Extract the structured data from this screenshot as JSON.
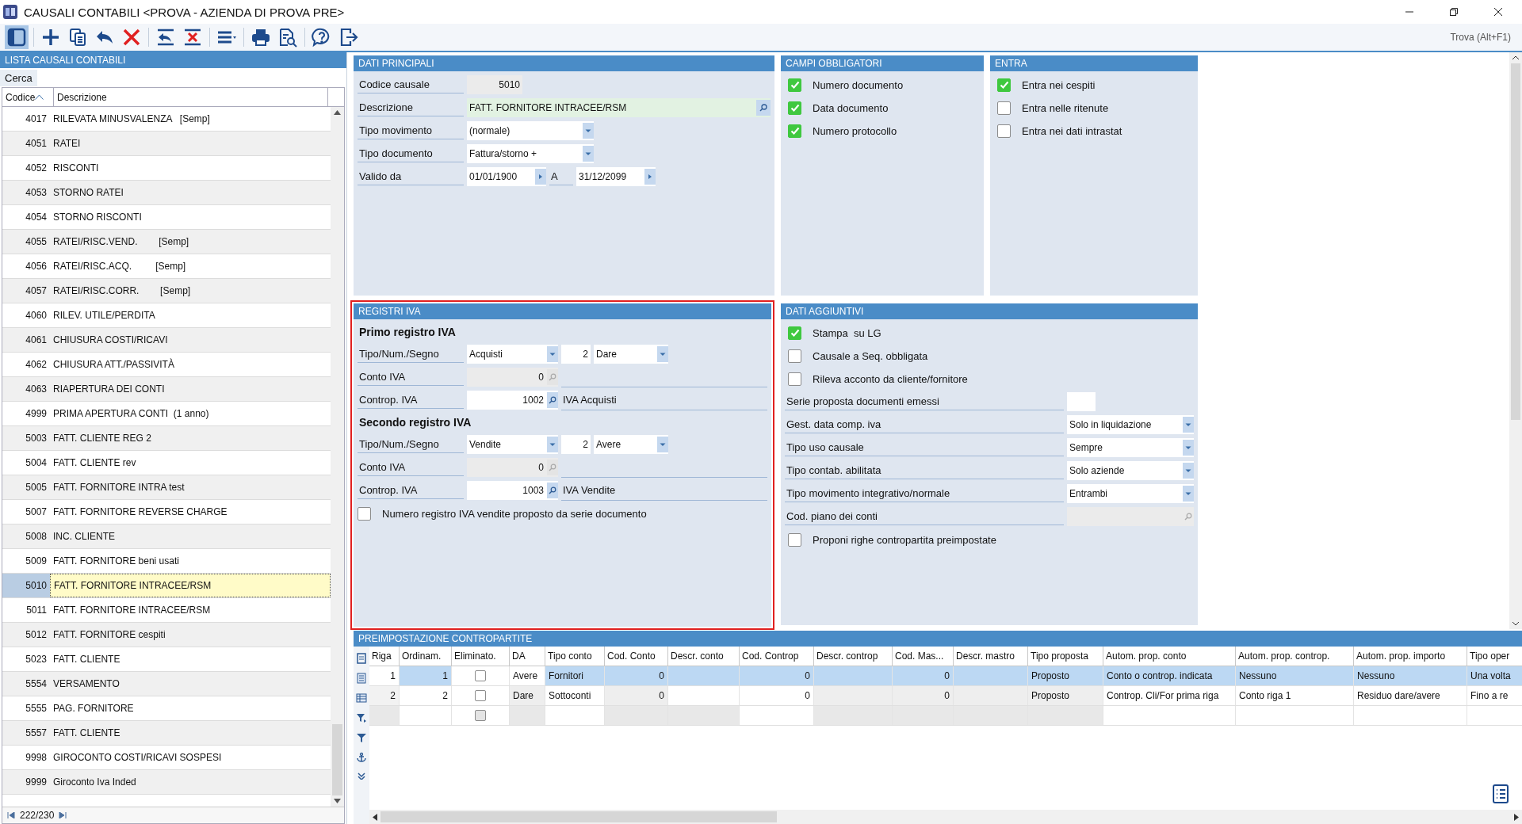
{
  "window": {
    "title": "CAUSALI CONTABILI <PROVA - AZIENDA DI PROVA PRE>"
  },
  "toolbar": {
    "buttons": [
      {
        "kind": "panel",
        "selected": true
      },
      {
        "kind": "new",
        "selected": false
      },
      {
        "kind": "copy",
        "selected": false
      },
      {
        "kind": "undo",
        "selected": false
      },
      {
        "kind": "delete",
        "selected": false
      },
      {
        "kind": "undo-line",
        "selected": false
      },
      {
        "kind": "delete-line",
        "selected": false
      },
      {
        "kind": "menu",
        "selected": false
      },
      {
        "kind": "print",
        "selected": false
      },
      {
        "kind": "preview",
        "selected": false
      },
      {
        "kind": "help",
        "selected": false
      },
      {
        "kind": "exit",
        "selected": false
      }
    ],
    "find_hint": "Trova (Alt+F1)"
  },
  "list": {
    "title": "LISTA CAUSALI CONTABILI",
    "search_label": "Cerca",
    "columns": [
      "Codice",
      "Descrizione"
    ],
    "rows": [
      {
        "code": "4017",
        "description": "RILEVATA MINUSVALENZA   [Semp]",
        "selected": false
      },
      {
        "code": "4051",
        "description": "RATEI",
        "selected": false
      },
      {
        "code": "4052",
        "description": "RISCONTI",
        "selected": false
      },
      {
        "code": "4053",
        "description": "STORNO RATEI",
        "selected": false
      },
      {
        "code": "4054",
        "description": "STORNO RISCONTI",
        "selected": false
      },
      {
        "code": "4055",
        "description": "RATEI/RISC.VEND.        [Semp]",
        "selected": false
      },
      {
        "code": "4056",
        "description": "RATEI/RISC.ACQ.         [Semp]",
        "selected": false
      },
      {
        "code": "4057",
        "description": "RATEI/RISC.CORR.        [Semp]",
        "selected": false
      },
      {
        "code": "4060",
        "description": "RILEV. UTILE/PERDITA",
        "selected": false
      },
      {
        "code": "4061",
        "description": "CHIUSURA COSTI/RICAVI",
        "selected": false
      },
      {
        "code": "4062",
        "description": "CHIUSURA ATT./PASSIVITÀ",
        "selected": false
      },
      {
        "code": "4063",
        "description": "RIAPERTURA DEI CONTI",
        "selected": false
      },
      {
        "code": "4999",
        "description": "PRIMA APERTURA CONTI  (1 anno)",
        "selected": false
      },
      {
        "code": "5003",
        "description": "FATT. CLIENTE REG 2",
        "selected": false
      },
      {
        "code": "5004",
        "description": "FATT. CLIENTE rev",
        "selected": false
      },
      {
        "code": "5005",
        "description": "FATT. FORNITORE INTRA test",
        "selected": false
      },
      {
        "code": "5007",
        "description": "FATT. FORNITORE REVERSE CHARGE",
        "selected": false
      },
      {
        "code": "5008",
        "description": "INC. CLIENTE",
        "selected": false
      },
      {
        "code": "5009",
        "description": "FATT. FORNITORE beni usati",
        "selected": false
      },
      {
        "code": "5010",
        "description": "FATT. FORNITORE INTRACEE/RSM",
        "selected": true
      },
      {
        "code": "5011",
        "description": "FATT. FORNITORE INTRACEE/RSM",
        "selected": false
      },
      {
        "code": "5012",
        "description": "FATT. FORNITORE cespiti",
        "selected": false
      },
      {
        "code": "5023",
        "description": "FATT. CLIENTE",
        "selected": false
      },
      {
        "code": "5554",
        "description": "VERSAMENTO",
        "selected": false
      },
      {
        "code": "5555",
        "description": "PAG. FORNITORE",
        "selected": false
      },
      {
        "code": "5557",
        "description": "FATT. CLIENTE",
        "selected": false
      },
      {
        "code": "9998",
        "description": "GIROCONTO COSTI/RICAVI SOSPESI",
        "selected": false
      },
      {
        "code": "9999",
        "description": "Giroconto Iva Inded",
        "selected": false
      }
    ],
    "pager": "222/230"
  },
  "dati_principali": {
    "title": "DATI PRINCIPALI",
    "fields": [
      {
        "label": "Codice causale",
        "kind": "readonly",
        "value": "5010"
      },
      {
        "label": "Descrizione",
        "kind": "lookup",
        "value": "FATT. FORNITORE INTRACEE/RSM"
      },
      {
        "label": "Tipo movimento",
        "kind": "select",
        "value": "(normale)"
      },
      {
        "label": "Tipo documento",
        "kind": "select",
        "value": "Fattura/storno +"
      },
      {
        "label": "Valido da",
        "kind": "range",
        "value": "01/01/1900",
        "to_label": "A",
        "to_value": "31/12/2099"
      }
    ]
  },
  "campi_obbligatori": {
    "title": "CAMPI OBBLIGATORI",
    "items": [
      {
        "label": "Numero documento",
        "checked": true
      },
      {
        "label": "Data documento",
        "checked": true
      },
      {
        "label": "Numero protocollo",
        "checked": true
      }
    ]
  },
  "entra": {
    "title": "ENTRA",
    "items": [
      {
        "label": "Entra nei cespiti",
        "checked": true
      },
      {
        "label": "Entra nelle ritenute",
        "checked": false
      },
      {
        "label": "Entra nei dati intrastat",
        "checked": false
      }
    ]
  },
  "registri_iva": {
    "title": "REGISTRI IVA",
    "focused": true,
    "sections": [
      {
        "heading": "Primo registro IVA",
        "rows": [
          {
            "label": "Tipo/Num./Segno",
            "kind": "tipo",
            "tipo": "Acquisti",
            "num": "2",
            "segno": "Dare"
          },
          {
            "label": "Conto IVA",
            "kind": "conto",
            "value": "0",
            "disabled": true
          },
          {
            "label": "Controp. IVA",
            "kind": "conto",
            "value": "1002",
            "description": "IVA Acquisti",
            "disabled": false
          }
        ]
      },
      {
        "heading": "Secondo registro IVA",
        "rows": [
          {
            "label": "Tipo/Num./Segno",
            "kind": "tipo",
            "tipo": "Vendite",
            "num": "2",
            "segno": "Avere"
          },
          {
            "label": "Conto IVA",
            "kind": "conto",
            "value": "0",
            "disabled": true
          },
          {
            "label": "Controp. IVA",
            "kind": "conto",
            "value": "1003",
            "description": "IVA Vendite",
            "disabled": false
          }
        ]
      }
    ],
    "option": {
      "label": "Numero registro IVA vendite proposto da serie documento",
      "checked": false
    }
  },
  "dati_aggiuntivi": {
    "title": "DATI AGGIUNTIVI",
    "items": [
      {
        "kind": "check",
        "label": "Stampa  su LG",
        "checked": true
      },
      {
        "kind": "check",
        "label": "Causale a Seq. obbligata",
        "checked": false
      },
      {
        "kind": "check",
        "label": "Rileva acconto da cliente/fornitore",
        "checked": false
      },
      {
        "kind": "text",
        "label": "Serie proposta documenti emessi"
      },
      {
        "kind": "select",
        "label": "Gest. data comp. iva",
        "value": "Solo in liquidazione"
      },
      {
        "kind": "select",
        "label": "Tipo uso causale",
        "value": "Sempre"
      },
      {
        "kind": "select",
        "label": "Tipo contab. abilitata",
        "value": "Solo aziende"
      },
      {
        "kind": "select",
        "label": "Tipo movimento integrativo/normale",
        "value": "Entrambi"
      },
      {
        "kind": "lookup",
        "label": "Cod. piano dei conti",
        "disabled": true
      },
      {
        "kind": "check",
        "label": "Proponi righe contropartita preimpostate",
        "checked": false
      }
    ]
  },
  "preimpostazione": {
    "title": "PREIMPOSTAZIONE CONTROPARTITE",
    "columns": [
      "Riga",
      "Ordinam.",
      "Eliminato.",
      "DA",
      "Tipo conto",
      "Cod. Conto",
      "Descr. conto",
      "Cod. Controp",
      "Descr. controp",
      "Cod. Mas...",
      "Descr. mastro",
      "Tipo proposta",
      "Autom. prop. conto",
      "Autom. prop. controp.",
      "Autom. prop. importo",
      "Tipo oper"
    ],
    "rows": [
      {
        "kind": "data",
        "selected": true,
        "eliminato": false,
        "cells": [
          "1",
          "1",
          null,
          "Avere",
          "Fornitori",
          "0",
          null,
          "0",
          null,
          "0",
          null,
          "Proposto",
          "Conto o controp. indicata",
          "Nessuno",
          "Nessuno",
          "Una volta"
        ]
      },
      {
        "kind": "data",
        "selected": false,
        "eliminato": false,
        "cells": [
          "2",
          "2",
          null,
          "Dare",
          "Sottoconti",
          "0",
          null,
          "0",
          null,
          "0",
          null,
          "Proposto",
          "Controp. Cli/For prima riga",
          "Conto riga 1",
          "Residuo dare/avere",
          "Fino a re"
        ]
      },
      {
        "kind": "new",
        "selected": false,
        "eliminato": false,
        "cells": []
      }
    ]
  }
}
